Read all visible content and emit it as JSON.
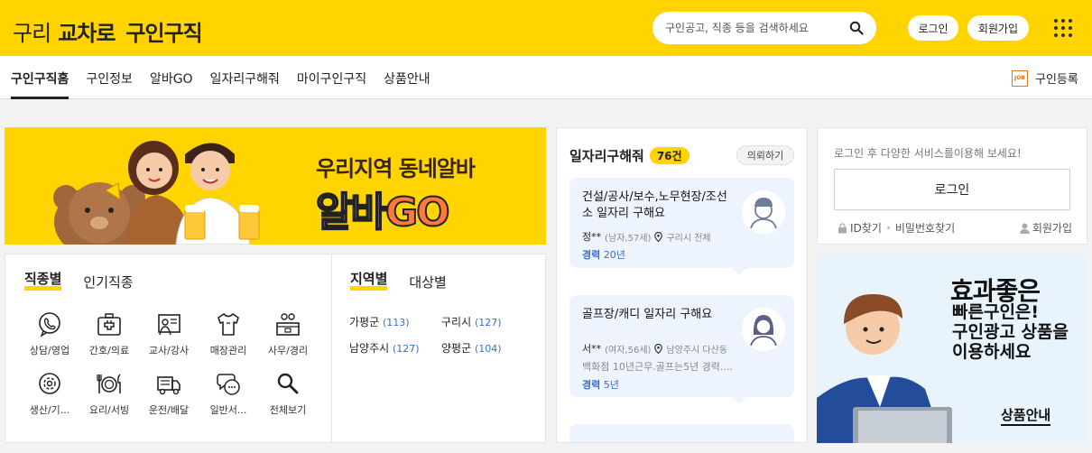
{
  "header": {
    "logo_main": "구리",
    "logo_brand": "교차로",
    "logo_sub": "구인구직",
    "search_placeholder": "구인공고, 직종 등을 검색하세요",
    "login_label": "로그인",
    "join_label": "회원가입"
  },
  "nav": {
    "items": [
      {
        "label": "구인구직홈",
        "active": true
      },
      {
        "label": "구인정보"
      },
      {
        "label": "알바GO"
      },
      {
        "label": "일자리구해줘"
      },
      {
        "label": "마이구인구직"
      },
      {
        "label": "상품안내"
      }
    ],
    "register_label": "구인등록",
    "register_icon": "JOB"
  },
  "banner": {
    "line1": "우리지역 동네알바",
    "line2a": "알바",
    "line2b": "GO"
  },
  "category_tabs": [
    "직종별",
    "인기직종"
  ],
  "categories": [
    {
      "label": "상담/영업",
      "icon": "phone-chat-icon"
    },
    {
      "label": "간호/의료",
      "icon": "medical-kit-icon"
    },
    {
      "label": "교사/강사",
      "icon": "teacher-icon"
    },
    {
      "label": "매장관리",
      "icon": "shirt-icon"
    },
    {
      "label": "사무/경리",
      "icon": "office-icon"
    },
    {
      "label": "생산/기...",
      "icon": "gear-icon"
    },
    {
      "label": "요리/서빙",
      "icon": "dining-icon"
    },
    {
      "label": "운전/배달",
      "icon": "truck-icon"
    },
    {
      "label": "일반서...",
      "icon": "chat-bubble-icon"
    },
    {
      "label": "전체보기",
      "icon": "search-icon"
    }
  ],
  "region_tabs": [
    "지역별",
    "대상별"
  ],
  "regions": [
    {
      "name": "가평군",
      "count": "(113)"
    },
    {
      "name": "구리시",
      "count": "(127)"
    },
    {
      "name": "남양주시",
      "count": "(127)"
    },
    {
      "name": "양평군",
      "count": "(104)"
    }
  ],
  "job_requests": {
    "title": "일자리구해줘",
    "count": "76건",
    "request_button": "의뢰하기",
    "cards": [
      {
        "title": "건설/공사/보수,노무현장/조선소 일자리 구해요",
        "name": "정**",
        "info": "(남자,57세)",
        "location": "구리시 전체",
        "desc": "",
        "exp_label": "경력",
        "exp_value": "20년"
      },
      {
        "title": "골프장/캐디 일자리 구해요",
        "name": "서**",
        "info": "(여자,56세)",
        "location": "남양주시 다산동",
        "desc": "백화점 10년근무.골프는5년 경력....",
        "exp_label": "경력",
        "exp_value": "5년"
      }
    ]
  },
  "login_box": {
    "message": "로그인 후 다양한 서비스를이용해 보세요!",
    "login_button": "로그인",
    "find_id": "ID찾기",
    "find_pw": "비밀번호찾기",
    "join": "회원가입"
  },
  "ad": {
    "headline": "효과좋은",
    "line2": "빠른구인은!",
    "line3": "구인광고 상품을",
    "line4": "이용하세요",
    "more": "상품안내"
  }
}
